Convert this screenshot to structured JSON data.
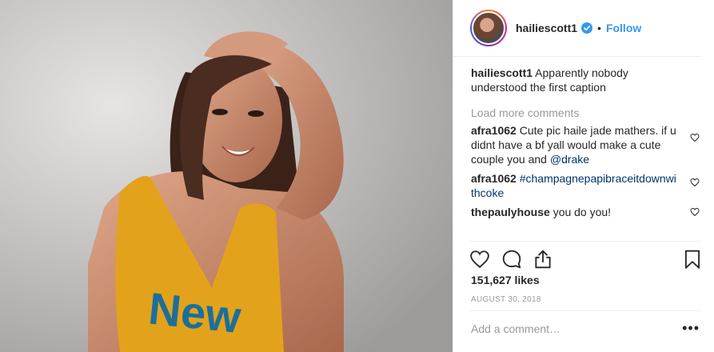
{
  "post": {
    "author": "hailiescott1",
    "follow_label": "Follow",
    "separator": "•",
    "verified_icon": "verified-badge-icon"
  },
  "comments": {
    "caption": {
      "user": "hailiescott1",
      "text": "Apparently nobody understood the first caption"
    },
    "load_more": "Load more comments",
    "items": [
      {
        "user": "afra1062",
        "text": "Cute pic haile jade mathers. if u didnt have a bf yall would make a cute couple you and ",
        "mention": "@drake"
      },
      {
        "user": "afra1062",
        "text": "",
        "hashtag": "#champagnepapibraceitdownwithcoke"
      },
      {
        "user": "thepaulyhouse",
        "text": "you do you!"
      }
    ]
  },
  "stats": {
    "likes": "151,627 likes",
    "date": "AUGUST 30, 2018"
  },
  "composer": {
    "placeholder": "Add a comment…",
    "more_label": "•••"
  },
  "colors": {
    "link": "#3897f0",
    "mention": "#003569",
    "muted": "#999999",
    "text": "#262626"
  }
}
